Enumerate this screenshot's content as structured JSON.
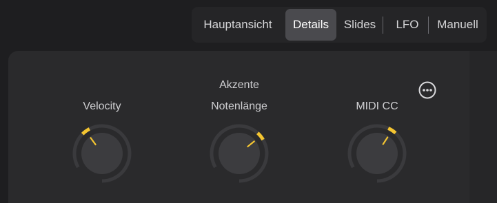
{
  "tabs": [
    {
      "label": "Hauptansicht",
      "active": false
    },
    {
      "label": "Details",
      "active": true
    },
    {
      "label": "Slides",
      "active": false
    },
    {
      "label": "LFO",
      "active": false
    },
    {
      "label": "Manuell",
      "active": false
    }
  ],
  "panel": {
    "group_title": "Akzente",
    "more_icon": "ellipsis-circle-icon"
  },
  "knobs": [
    {
      "label": "Velocity",
      "value": 0.28
    },
    {
      "label": "Notenlänge",
      "value": 0.57
    },
    {
      "label": "MIDI CC",
      "value": 0.51
    }
  ],
  "colors": {
    "accent": "#f4c531",
    "track": "#3a3a3d",
    "knob_body": "#3c3c3f"
  }
}
